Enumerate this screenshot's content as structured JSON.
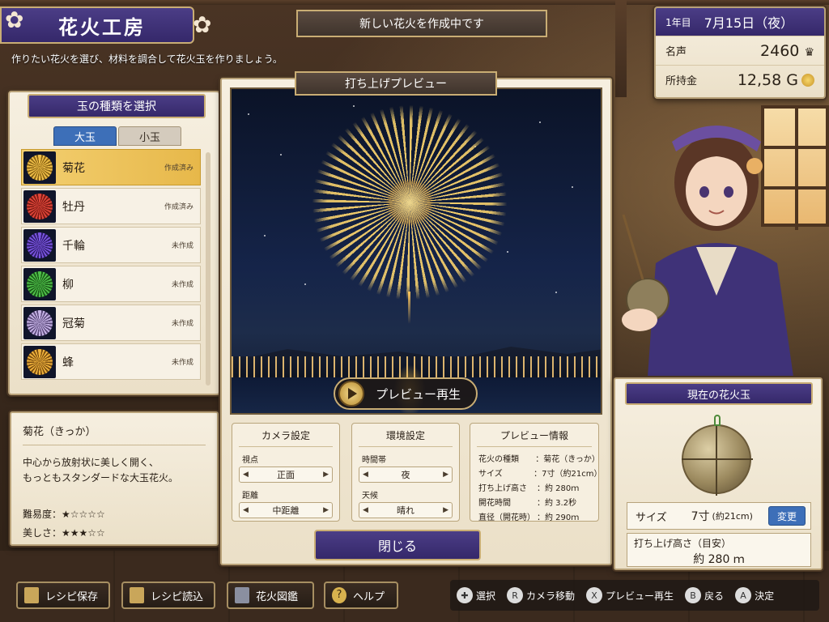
{
  "header": {
    "title": "花火工房",
    "subtitle": "作りたい花火を選び、材料を調合して花火玉を作りましょう。",
    "status": "新しい花火を作成中です"
  },
  "info": {
    "year": "1年目",
    "date": "7月15日（夜）",
    "fame_label": "名声",
    "fame_value": "2460",
    "money_label": "所持金",
    "money_value": "12,58 G"
  },
  "shell_select": {
    "title": "玉の種類を選択",
    "tabs": [
      "大玉",
      "小玉"
    ],
    "items": [
      {
        "name": "菊花",
        "status": "作成済み",
        "color": "#f1c04a"
      },
      {
        "name": "牡丹",
        "status": "作成済み",
        "color": "#e0453a"
      },
      {
        "name": "千輪",
        "status": "未作成",
        "color": "#7a55e0"
      },
      {
        "name": "柳",
        "status": "未作成",
        "color": "#4fbf4a"
      },
      {
        "name": "冠菊",
        "status": "未作成",
        "color": "#c6b3e6"
      },
      {
        "name": "蜂",
        "status": "未作成",
        "color": "#f0b23c"
      }
    ]
  },
  "description": {
    "title": "菊花（きっか）",
    "body1": "中心から放射状に美しく開く、",
    "body2": "もっともスタンダードな大玉花火。",
    "difficulty_label": "難易度：",
    "difficulty_stars": "★☆☆☆☆",
    "beauty_label": "美しさ：",
    "beauty_stars": "★★★☆☆"
  },
  "preview": {
    "title": "打ち上げプレビュー",
    "play_label": "プレビュー再生"
  },
  "camera": {
    "title": "カメラ設定",
    "viewpoint_label": "視点",
    "viewpoint_value": "正面",
    "distance_label": "距離",
    "distance_value": "中距離"
  },
  "environment": {
    "title": "環境設定",
    "time_label": "時間帯",
    "time_value": "夜",
    "weather_label": "天候",
    "weather_value": "晴れ"
  },
  "preview_info": {
    "title": "プレビュー情報",
    "rows": [
      {
        "k": "花火の種類",
        "v": "：菊花（きっか）"
      },
      {
        "k": "サイズ",
        "v": "：7寸（約21cm）"
      },
      {
        "k": "打ち上げ高さ",
        "v": "：約 280ｍ"
      },
      {
        "k": "開花時間",
        "v": "：約 3.2秒"
      },
      {
        "k": "直径（開花時）",
        "v": "：約 290ｍ"
      }
    ]
  },
  "close_label": "閉じる",
  "current_shell": {
    "title": "現在の花火玉",
    "size_label": "サイズ",
    "size_value": "7寸",
    "size_sub": "(約21cm)",
    "change_label": "変更",
    "height_label": "打ち上げ高さ（目安）",
    "height_value": "約 280 ｍ"
  },
  "bottom_buttons": [
    "レシピ保存",
    "レシピ読込",
    "花火図鑑",
    "ヘルプ"
  ],
  "hints": [
    {
      "key": "✚",
      "label": "選択"
    },
    {
      "key": "R",
      "label": "カメラ移動"
    },
    {
      "key": "X",
      "label": "プレビュー再生"
    },
    {
      "key": "B",
      "label": "戻る"
    },
    {
      "key": "A",
      "label": "決定"
    }
  ],
  "colors": {
    "accent_purple": "#3f3278",
    "selected_gold": "#e7b84a",
    "tab_blue": "#3d6fb8"
  }
}
